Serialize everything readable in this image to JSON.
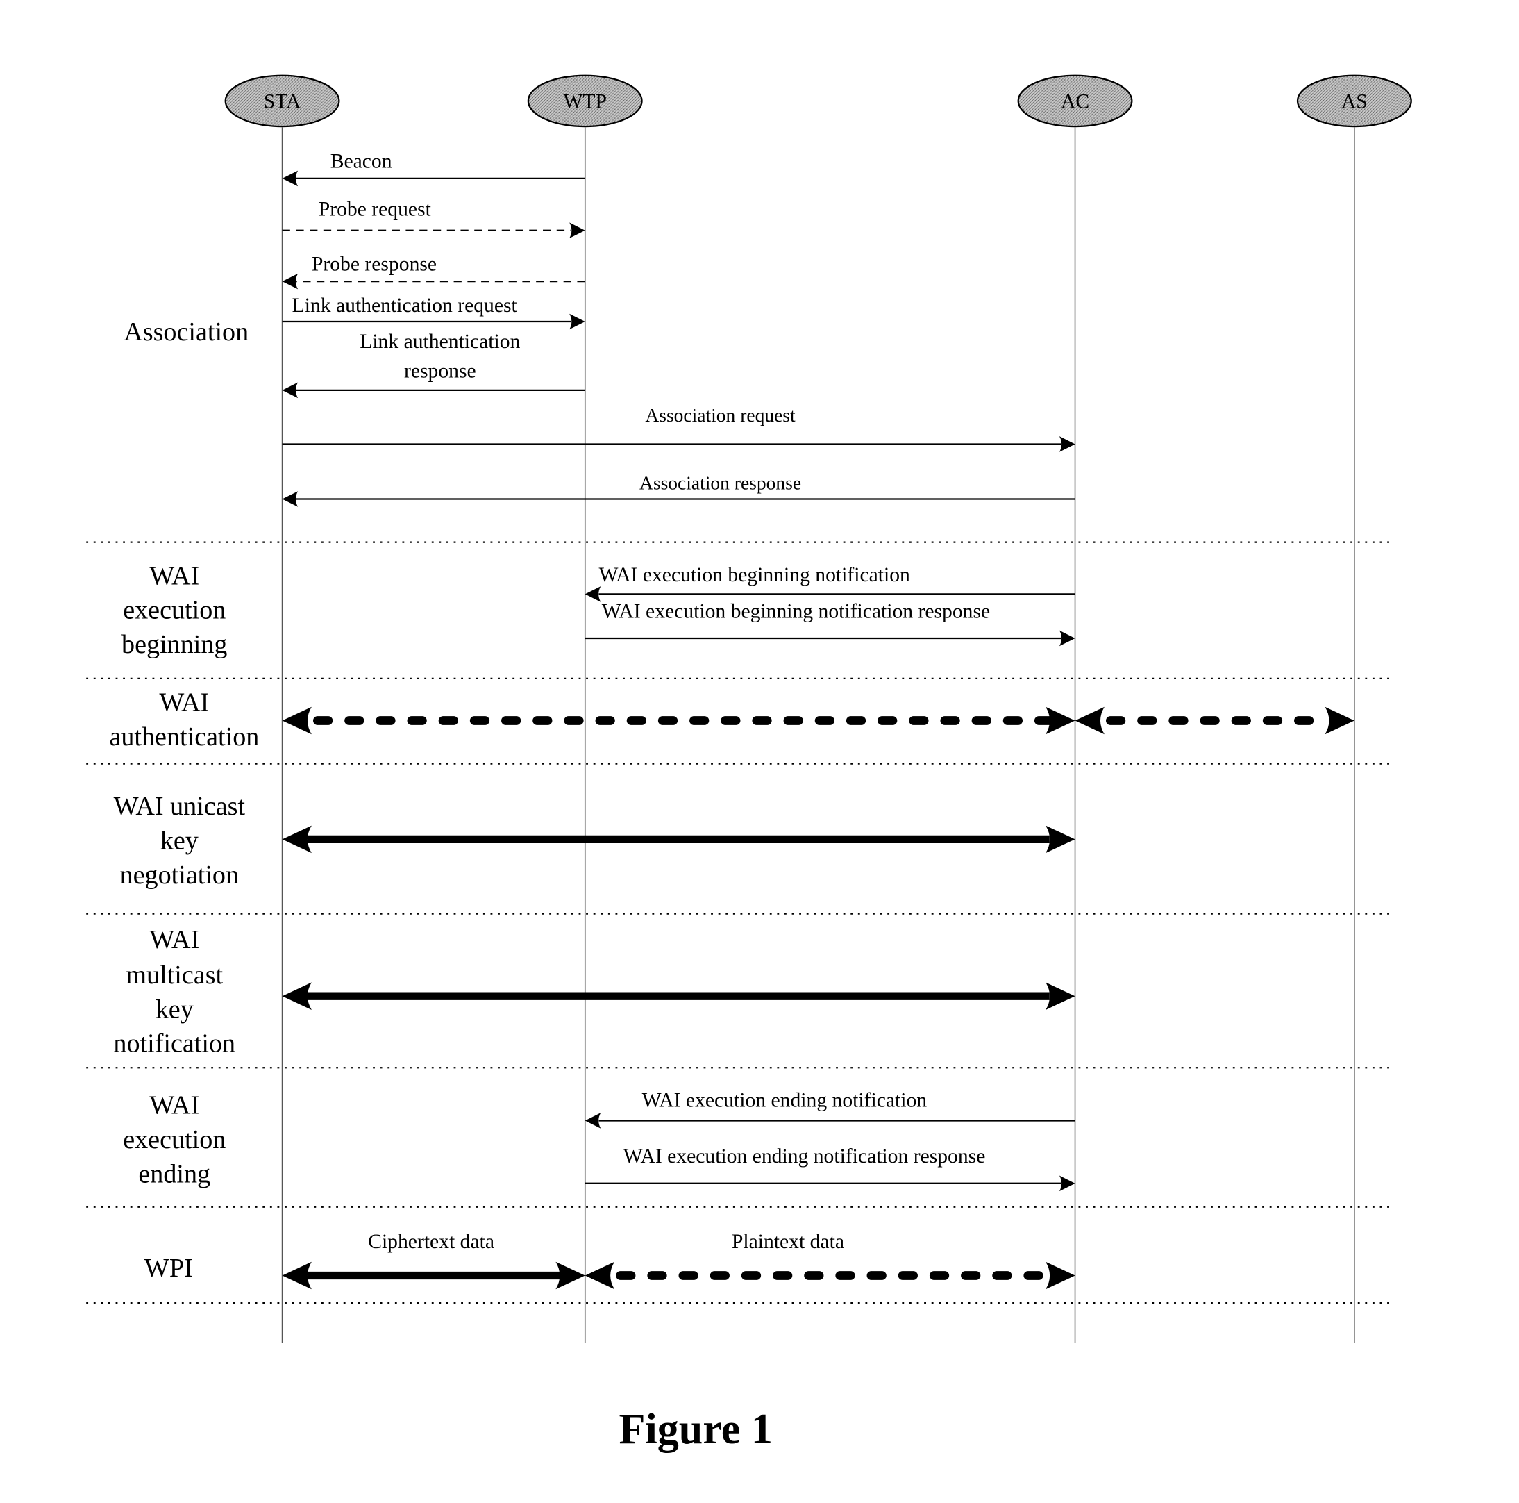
{
  "figure": {
    "caption": "Figure 1",
    "type": "sequence-diagram"
  },
  "colors": {
    "ink": "#000000",
    "participant_fill": "#b4b4b4",
    "lifeline": "#555555",
    "background": "#ffffff"
  },
  "participants": [
    {
      "id": "STA",
      "label": "STA"
    },
    {
      "id": "WTP",
      "label": "WTP"
    },
    {
      "id": "AC",
      "label": "AC"
    },
    {
      "id": "AS",
      "label": "AS"
    }
  ],
  "phases": [
    {
      "id": "association",
      "lines": [
        "Association"
      ]
    },
    {
      "id": "wai-execution-beginning",
      "lines": [
        "WAI",
        "execution",
        "beginning"
      ]
    },
    {
      "id": "wai-authentication",
      "lines": [
        "WAI",
        "authentication"
      ]
    },
    {
      "id": "wai-unicast-key-negotiation",
      "lines": [
        "WAI unicast",
        "key",
        "negotiation"
      ]
    },
    {
      "id": "wai-multicast-key-notification",
      "lines": [
        "WAI",
        "multicast",
        "key",
        "notification"
      ]
    },
    {
      "id": "wai-execution-ending",
      "lines": [
        "WAI",
        "execution",
        "ending"
      ]
    },
    {
      "id": "wpi",
      "lines": [
        "WPI"
      ]
    }
  ],
  "messages": [
    {
      "id": "beacon",
      "phase": "association",
      "from": "WTP",
      "to": "STA",
      "style": "solid",
      "label": [
        "Beacon"
      ]
    },
    {
      "id": "probe-request",
      "phase": "association",
      "from": "STA",
      "to": "WTP",
      "style": "dashed",
      "label": [
        "Probe request"
      ]
    },
    {
      "id": "probe-response",
      "phase": "association",
      "from": "WTP",
      "to": "STA",
      "style": "dashed",
      "label": [
        "Probe response"
      ]
    },
    {
      "id": "link-authentication-request",
      "phase": "association",
      "from": "STA",
      "to": "WTP",
      "style": "solid",
      "label": [
        "Link authentication request"
      ]
    },
    {
      "id": "link-authentication-response",
      "phase": "association",
      "from": "WTP",
      "to": "STA",
      "style": "solid",
      "label": [
        "Link authentication",
        "response"
      ]
    },
    {
      "id": "association-request",
      "phase": "association",
      "from": "STA",
      "to": "AC",
      "style": "solid",
      "label": [
        "Association request"
      ]
    },
    {
      "id": "association-response",
      "phase": "association",
      "from": "AC",
      "to": "STA",
      "style": "solid",
      "label": [
        "Association response"
      ]
    },
    {
      "id": "wai-execution-beginning-notification",
      "phase": "wai-execution-beginning",
      "from": "AC",
      "to": "WTP",
      "style": "solid",
      "label": [
        "WAI execution beginning notification"
      ]
    },
    {
      "id": "wai-execution-beginning-notification-response",
      "phase": "wai-execution-beginning",
      "from": "WTP",
      "to": "AC",
      "style": "solid",
      "label": [
        "WAI execution beginning notification response"
      ]
    },
    {
      "id": "wai-authentication-sta-ac",
      "phase": "wai-authentication",
      "from": "STA",
      "to": "AC",
      "style": "bold-dotted-bidirectional",
      "label": []
    },
    {
      "id": "wai-authentication-ac-as",
      "phase": "wai-authentication",
      "from": "AC",
      "to": "AS",
      "style": "bold-dotted-bidirectional",
      "label": []
    },
    {
      "id": "wai-unicast-key-negotiation",
      "phase": "wai-unicast-key-negotiation",
      "from": "STA",
      "to": "AC",
      "style": "bold-solid-bidirectional",
      "label": []
    },
    {
      "id": "wai-multicast-key-notification",
      "phase": "wai-multicast-key-notification",
      "from": "STA",
      "to": "AC",
      "style": "bold-solid-bidirectional",
      "label": []
    },
    {
      "id": "wai-execution-ending-notification",
      "phase": "wai-execution-ending",
      "from": "AC",
      "to": "WTP",
      "style": "solid",
      "label": [
        "WAI execution ending notification"
      ]
    },
    {
      "id": "wai-execution-ending-notification-response",
      "phase": "wai-execution-ending",
      "from": "WTP",
      "to": "AC",
      "style": "solid",
      "label": [
        "WAI execution ending notification response"
      ]
    },
    {
      "id": "ciphertext-data",
      "phase": "wpi",
      "from": "STA",
      "to": "WTP",
      "style": "bold-solid-bidirectional",
      "label": [
        "Ciphertext data"
      ]
    },
    {
      "id": "plaintext-data",
      "phase": "wpi",
      "from": "WTP",
      "to": "AC",
      "style": "bold-dotted-bidirectional",
      "label": [
        "Plaintext data"
      ]
    }
  ]
}
